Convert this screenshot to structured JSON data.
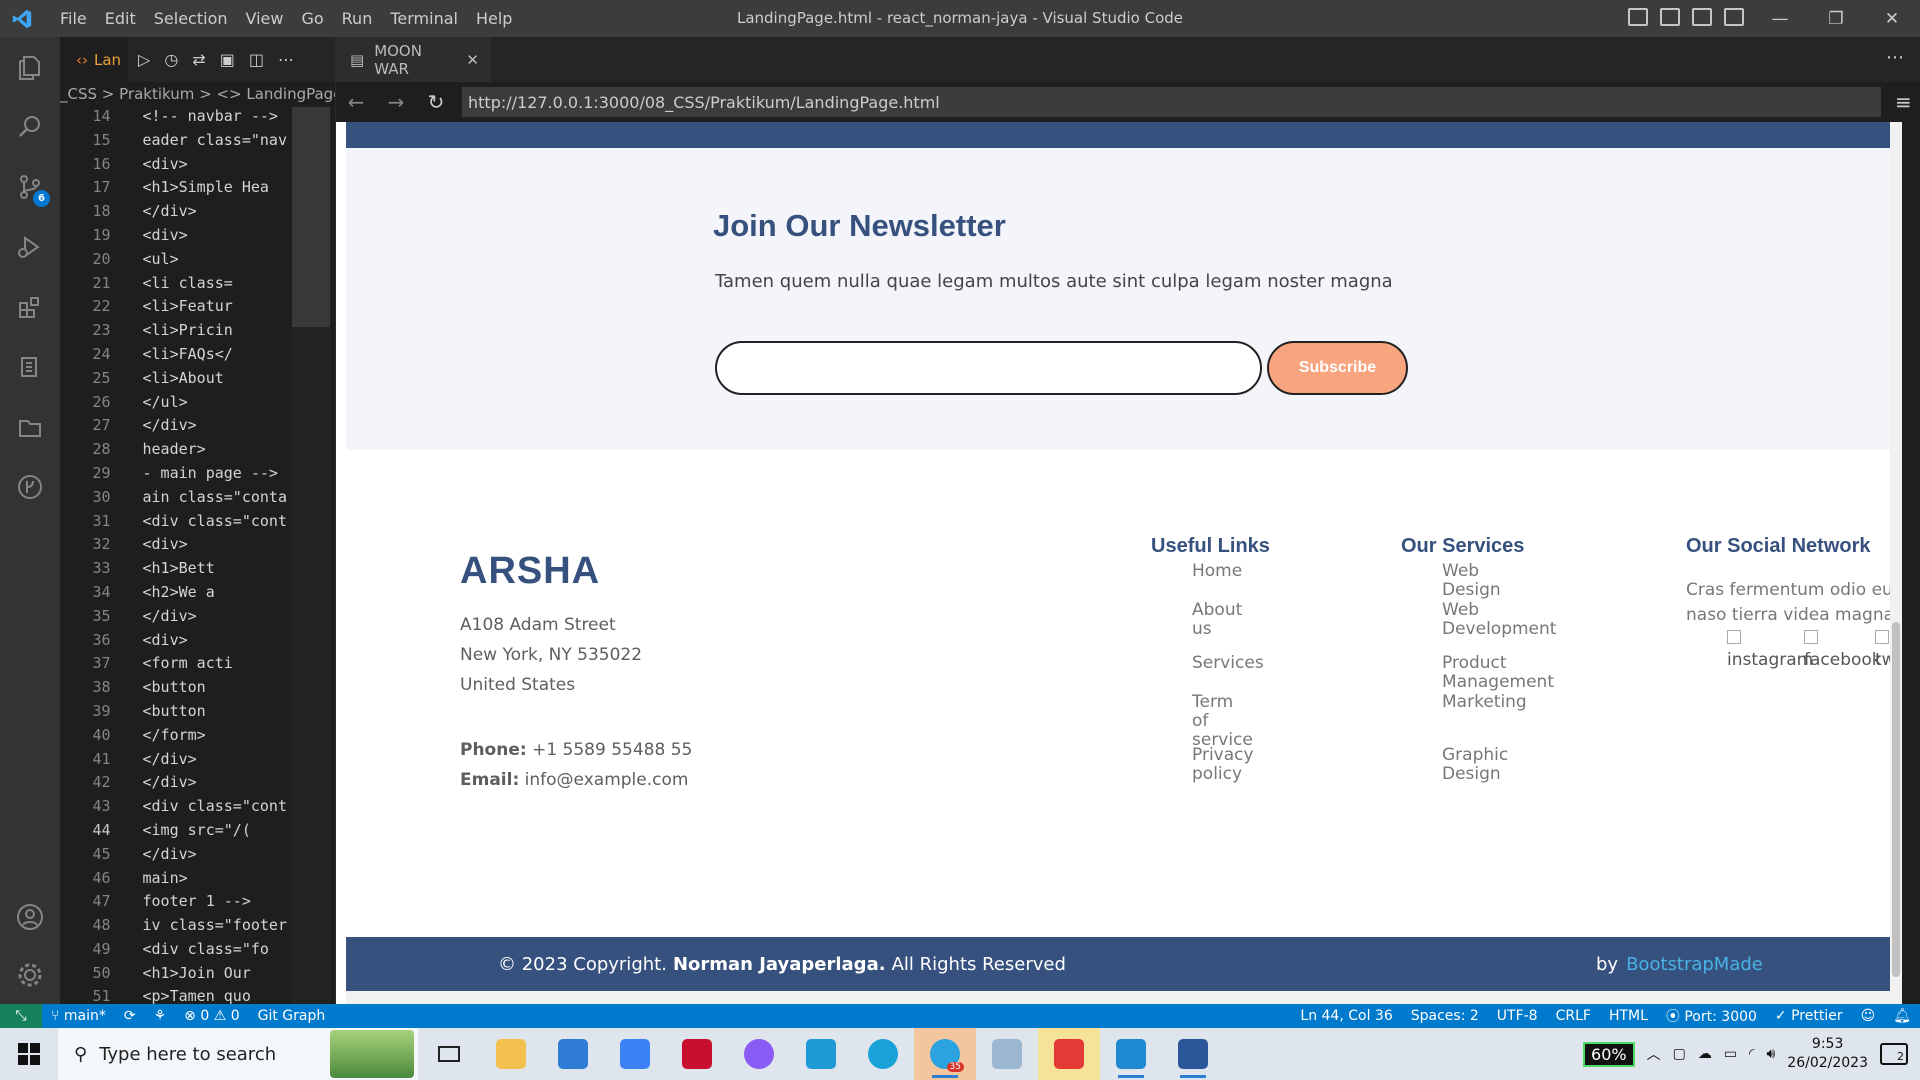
{
  "titlebar": {
    "menu": [
      "File",
      "Edit",
      "Selection",
      "View",
      "Go",
      "Run",
      "Terminal",
      "Help"
    ],
    "window_title": "LandingPage.html - react_norman-jaya - Visual Studio Code"
  },
  "activitybar": {
    "icons": [
      "explorer-icon",
      "search-icon",
      "source-control-icon",
      "run-debug-icon",
      "extensions-icon",
      "testing-icon",
      "folder-icon",
      "git-graph-icon",
      "account-icon",
      "settings-gear-icon"
    ],
    "scm_badge": "6"
  },
  "editor": {
    "tab_label": "Lan",
    "breadcrumb": "_CSS > Praktikum > <> LandingPage.h",
    "lines": [
      {
        "n": "14",
        "code": "<!-- navbar -->"
      },
      {
        "n": "15",
        "code": "eader class=\"nav"
      },
      {
        "n": "16",
        "code": "<div>"
      },
      {
        "n": "17",
        "code": "  <h1>Simple Hea"
      },
      {
        "n": "18",
        "code": "</div>"
      },
      {
        "n": "19",
        "code": "<div>"
      },
      {
        "n": "20",
        "code": "  <ul>"
      },
      {
        "n": "21",
        "code": "      <li class="
      },
      {
        "n": "22",
        "code": "      <li>Featur"
      },
      {
        "n": "23",
        "code": "      <li>Pricin"
      },
      {
        "n": "24",
        "code": "      <li>FAQs</"
      },
      {
        "n": "25",
        "code": "      <li>About"
      },
      {
        "n": "26",
        "code": "  </ul>"
      },
      {
        "n": "27",
        "code": "</div>"
      },
      {
        "n": "28",
        "code": "header>"
      },
      {
        "n": "29",
        "code": "- main page -->"
      },
      {
        "n": "30",
        "code": "ain class=\"conta"
      },
      {
        "n": "31",
        "code": "<div class=\"cont"
      },
      {
        "n": "32",
        "code": "    <div>"
      },
      {
        "n": "33",
        "code": "        <h1>Bett"
      },
      {
        "n": "34",
        "code": "        <h2>We a"
      },
      {
        "n": "35",
        "code": "    </div>"
      },
      {
        "n": "36",
        "code": "    <div>"
      },
      {
        "n": "37",
        "code": "      <form acti"
      },
      {
        "n": "38",
        "code": "        <button"
      },
      {
        "n": "39",
        "code": "        <button"
      },
      {
        "n": "40",
        "code": "      </form>"
      },
      {
        "n": "41",
        "code": "    </div>"
      },
      {
        "n": "42",
        "code": "</div>"
      },
      {
        "n": "43",
        "code": "<div class=\"cont"
      },
      {
        "n": "44",
        "code": "    <img src=\"/("
      },
      {
        "n": "45",
        "code": "</div>"
      },
      {
        "n": "46",
        "code": "main>"
      },
      {
        "n": "47",
        "code": " footer 1 -->"
      },
      {
        "n": "48",
        "code": "iv class=\"footer"
      },
      {
        "n": "49",
        "code": "  <div class=\"fo"
      },
      {
        "n": "50",
        "code": "    <h1>Join Our"
      },
      {
        "n": "51",
        "code": "    <p>Tamen quo"
      }
    ]
  },
  "browser": {
    "tab_label": "MOON WAR",
    "url": "http://127.0.0.1:3000/08_CSS/Praktikum/LandingPage.html"
  },
  "page": {
    "newsletter": {
      "title": "Join Our Newsletter",
      "text": "Tamen quem nulla quae legam multos aute sint culpa legam noster magna",
      "input_value": "",
      "button": "Subscribe"
    },
    "footer": {
      "brand": "ARSHA",
      "address": [
        "A108 Adam Street",
        "New York, NY 535022",
        "United States"
      ],
      "phone_label": "Phone:",
      "phone": "+1 5589 55488 55",
      "email_label": "Email:",
      "email": "info@example.com",
      "useful_links_title": "Useful Links",
      "useful_links": [
        [
          "Home"
        ],
        [
          "About",
          "us"
        ],
        [
          "Services"
        ],
        [
          "Term of",
          "service"
        ],
        [
          "Privacy",
          "policy"
        ]
      ],
      "services_title": "Our Services",
      "services": [
        [
          "Web Design"
        ],
        [
          "Web",
          "Development"
        ],
        [
          "Product",
          "Management"
        ],
        [
          "Marketing"
        ],
        [
          "Graphic",
          "Design"
        ]
      ],
      "social_title": "Our Social Network",
      "social_text": [
        "Cras fermentum odio eu feugi",
        "naso tierra videa magna derita"
      ],
      "social_images": [
        "instagram",
        "facebook",
        "tw"
      ]
    },
    "copyright": {
      "prefix": "© 2023 Copyright.",
      "name": "Norman Jayaperlaga.",
      "suffix": "All Rights Reserved",
      "by": "by",
      "link": "BootstrapMade"
    }
  },
  "statusbar": {
    "branch": "main*",
    "problems": "0",
    "warnings": "0",
    "git_graph": "Git Graph",
    "position": "Ln 44, Col 36",
    "spaces": "Spaces: 2",
    "encoding": "UTF-8",
    "eol": "CRLF",
    "language": "HTML",
    "port": "Port: 3000",
    "prettier": "Prettier"
  },
  "taskbar": {
    "search_placeholder": "Type here to search",
    "battery": "60%",
    "time": "9:53",
    "date": "26/02/2023",
    "notifications": "2",
    "telegram_badge": "35"
  }
}
